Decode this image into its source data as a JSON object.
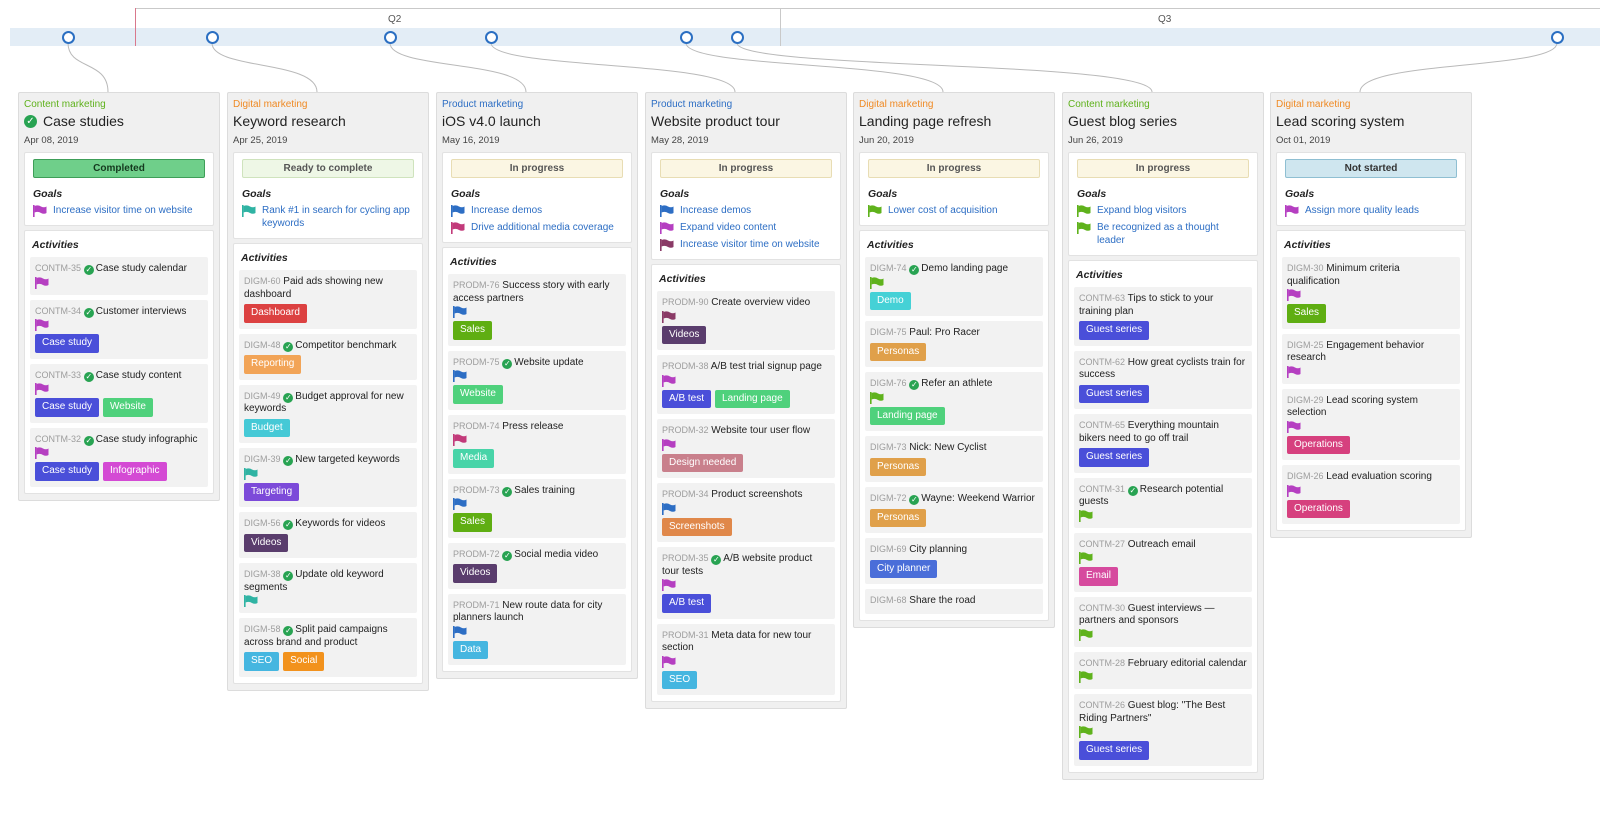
{
  "timeline": {
    "quarters": [
      "Q2",
      "Q3"
    ]
  },
  "categories": {
    "content": {
      "label": "Content marketing",
      "color": "#5fb21c"
    },
    "digital": {
      "label": "Digital marketing",
      "color": "#ef8a24"
    },
    "product": {
      "label": "Product marketing",
      "color": "#2d6ec4"
    }
  },
  "columns": [
    {
      "category": "Content marketing",
      "category_color": "#5fb21c",
      "title": "Case studies",
      "done": true,
      "date": "Apr 08, 2019",
      "status": "Completed",
      "status_style": "completed",
      "goals_label": "Goals",
      "goals": [
        {
          "text": "Increase visitor time on website",
          "flag": "#b53fc1"
        }
      ],
      "activities_label": "Activities",
      "activities": [
        {
          "key": "CONTM-35",
          "done": true,
          "title": "Case study calendar",
          "flag": "#b53fc1",
          "tags": []
        },
        {
          "key": "CONTM-34",
          "done": true,
          "title": "Customer interviews",
          "flag": "#b53fc1",
          "tags": [
            {
              "label": "Case study",
              "color": "#4a4fd9"
            }
          ]
        },
        {
          "key": "CONTM-33",
          "done": true,
          "title": "Case study content",
          "flag": "#b53fc1",
          "tags": [
            {
              "label": "Case study",
              "color": "#4a4fd9"
            },
            {
              "label": "Website",
              "color": "#4fd17c"
            }
          ]
        },
        {
          "key": "CONTM-32",
          "done": true,
          "title": "Case study infographic",
          "flag": "#b53fc1",
          "tags": [
            {
              "label": "Case study",
              "color": "#4a4fd9"
            },
            {
              "label": "Infographic",
              "color": "#d44ad4"
            }
          ]
        }
      ]
    },
    {
      "category": "Digital marketing",
      "category_color": "#ef8a24",
      "title": "Keyword research",
      "done": false,
      "date": "Apr 25, 2019",
      "status": "Ready to complete",
      "status_style": "ready",
      "goals_label": "Goals",
      "goals": [
        {
          "text": "Rank #1 in search for cycling app keywords",
          "flag": "#2fb3a3"
        }
      ],
      "activities_label": "Activities",
      "activities": [
        {
          "key": "DIGM-60",
          "done": false,
          "title": "Paid ads showing new dashboard",
          "flag": "",
          "tags": [
            {
              "label": "Dashboard",
              "color": "#dc4141"
            }
          ]
        },
        {
          "key": "DIGM-48",
          "done": true,
          "title": "Competitor benchmark",
          "flag": "",
          "tags": [
            {
              "label": "Reporting",
              "color": "#f2a457"
            }
          ]
        },
        {
          "key": "DIGM-49",
          "done": true,
          "title": "Budget approval for new keywords",
          "flag": "",
          "tags": [
            {
              "label": "Budget",
              "color": "#45c9d6"
            }
          ]
        },
        {
          "key": "DIGM-39",
          "done": true,
          "title": "New targeted keywords",
          "flag": "#2fb3a3",
          "tags": [
            {
              "label": "Targeting",
              "color": "#7c4ad9"
            }
          ]
        },
        {
          "key": "DIGM-56",
          "done": true,
          "title": "Keywords for videos",
          "flag": "",
          "tags": [
            {
              "label": "Videos",
              "color": "#5a3d6d"
            }
          ]
        },
        {
          "key": "DIGM-38",
          "done": true,
          "title": "Update old keyword segments",
          "flag": "#2fb3a3",
          "tags": []
        },
        {
          "key": "DIGM-58",
          "done": true,
          "title": "Split paid campaigns across brand and product",
          "flag": "",
          "tags": [
            {
              "label": "SEO",
              "color": "#45b6e0"
            },
            {
              "label": "Social",
              "color": "#f2921d"
            }
          ]
        }
      ]
    },
    {
      "category": "Product marketing",
      "category_color": "#2d6ec4",
      "title": "iOS v4.0 launch",
      "done": false,
      "date": "May 16, 2019",
      "status": "In progress",
      "status_style": "progress",
      "goals_label": "Goals",
      "goals": [
        {
          "text": "Increase demos",
          "flag": "#2d6ec4"
        },
        {
          "text": "Drive additional media coverage",
          "flag": "#c23a7a"
        }
      ],
      "activities_label": "Activities",
      "activities": [
        {
          "key": "PRODM-76",
          "done": false,
          "title": "Success story with early access partners",
          "flag": "#2d6ec4",
          "tags": [
            {
              "label": "Sales",
              "color": "#5fae12"
            }
          ]
        },
        {
          "key": "PRODM-75",
          "done": true,
          "title": "Website update",
          "flag": "#2d6ec4",
          "tags": [
            {
              "label": "Website",
              "color": "#4fd17c"
            }
          ]
        },
        {
          "key": "PRODM-74",
          "done": false,
          "title": "Press release",
          "flag": "#c23a7a",
          "tags": [
            {
              "label": "Media",
              "color": "#48d4a8"
            }
          ]
        },
        {
          "key": "PRODM-73",
          "done": true,
          "title": "Sales training",
          "flag": "#2d6ec4",
          "tags": [
            {
              "label": "Sales",
              "color": "#5fae12"
            }
          ]
        },
        {
          "key": "PRODM-72",
          "done": true,
          "title": "Social media video",
          "flag": "",
          "tags": [
            {
              "label": "Videos",
              "color": "#5a3d6d"
            }
          ]
        },
        {
          "key": "PRODM-71",
          "done": false,
          "title": "New route data for city planners launch",
          "flag": "#2d6ec4",
          "tags": [
            {
              "label": "Data",
              "color": "#45b6e0"
            }
          ]
        }
      ]
    },
    {
      "category": "Product marketing",
      "category_color": "#2d6ec4",
      "title": "Website product tour",
      "done": false,
      "date": "May 28, 2019",
      "status": "In progress",
      "status_style": "progress",
      "goals_label": "Goals",
      "goals": [
        {
          "text": "Increase demos",
          "flag": "#2d6ec4"
        },
        {
          "text": "Expand video content",
          "flag": "#b53fc1"
        },
        {
          "text": "Increase visitor time on website",
          "flag": "#8a3a66"
        }
      ],
      "activities_label": "Activities",
      "activities": [
        {
          "key": "PRODM-90",
          "done": false,
          "title": "Create overview video",
          "flag": "#8a3a66",
          "tags": [
            {
              "label": "Videos",
              "color": "#5a3d6d"
            }
          ]
        },
        {
          "key": "PRODM-38",
          "done": false,
          "title": "A/B test trial signup page",
          "flag": "#b53fc1",
          "tags": [
            {
              "label": "A/B test",
              "color": "#4a4fd9"
            },
            {
              "label": "Landing page",
              "color": "#4fd17c"
            }
          ]
        },
        {
          "key": "PRODM-32",
          "done": false,
          "title": "Website tour user flow",
          "flag": "#b53fc1",
          "tags": [
            {
              "label": "Design needed",
              "color": "#c9808c"
            }
          ]
        },
        {
          "key": "PRODM-34",
          "done": false,
          "title": "Product screenshots",
          "flag": "#2d6ec4",
          "tags": [
            {
              "label": "Screenshots",
              "color": "#e0884a"
            }
          ]
        },
        {
          "key": "PRODM-35",
          "done": true,
          "title": "A/B website product tour tests",
          "flag": "#b53fc1",
          "tags": [
            {
              "label": "A/B test",
              "color": "#4a4fd9"
            }
          ]
        },
        {
          "key": "PRODM-31",
          "done": false,
          "title": "Meta data for new tour section",
          "flag": "#b53fc1",
          "tags": [
            {
              "label": "SEO",
              "color": "#45b6e0"
            }
          ]
        }
      ]
    },
    {
      "category": "Digital marketing",
      "category_color": "#ef8a24",
      "title": "Landing page refresh",
      "done": false,
      "date": "Jun 20, 2019",
      "status": "In progress",
      "status_style": "progress",
      "goals_label": "Goals",
      "goals": [
        {
          "text": "Lower cost of acquisition",
          "flag": "#5fb21c"
        }
      ],
      "activities_label": "Activities",
      "activities": [
        {
          "key": "DIGM-74",
          "done": true,
          "title": "Demo landing page",
          "flag": "#5fb21c",
          "tags": [
            {
              "label": "Demo",
              "color": "#45d1d6"
            }
          ]
        },
        {
          "key": "DIGM-75",
          "done": false,
          "title": "Paul: Pro Racer",
          "flag": "",
          "tags": [
            {
              "label": "Personas",
              "color": "#e0a04a"
            }
          ]
        },
        {
          "key": "DIGM-76",
          "done": true,
          "title": "Refer an athlete",
          "flag": "#5fb21c",
          "tags": [
            {
              "label": "Landing page",
              "color": "#4fd17c"
            }
          ]
        },
        {
          "key": "DIGM-73",
          "done": false,
          "title": "Nick: New Cyclist",
          "flag": "",
          "tags": [
            {
              "label": "Personas",
              "color": "#e0a04a"
            }
          ]
        },
        {
          "key": "DIGM-72",
          "done": true,
          "title": "Wayne: Weekend Warrior",
          "flag": "",
          "tags": [
            {
              "label": "Personas",
              "color": "#e0a04a"
            }
          ]
        },
        {
          "key": "DIGM-69",
          "done": false,
          "title": "City planning",
          "flag": "",
          "tags": [
            {
              "label": "City planner",
              "color": "#4a6ed9"
            }
          ]
        },
        {
          "key": "DIGM-68",
          "done": false,
          "title": "Share the road",
          "flag": "",
          "tags": []
        }
      ]
    },
    {
      "category": "Content marketing",
      "category_color": "#5fb21c",
      "title": "Guest blog series",
      "done": false,
      "date": "Jun 26, 2019",
      "status": "In progress",
      "status_style": "progress",
      "goals_label": "Goals",
      "goals": [
        {
          "text": "Expand blog visitors",
          "flag": "#5fb21c"
        },
        {
          "text": "Be recognized as a thought leader",
          "flag": "#5fb21c"
        }
      ],
      "activities_label": "Activities",
      "activities": [
        {
          "key": "CONTM-63",
          "done": false,
          "title": "Tips to stick to your training plan",
          "flag": "",
          "tags": [
            {
              "label": "Guest series",
              "color": "#4a4fd9"
            }
          ]
        },
        {
          "key": "CONTM-62",
          "done": false,
          "title": "How great cyclists train for success",
          "flag": "",
          "tags": [
            {
              "label": "Guest series",
              "color": "#4a4fd9"
            }
          ]
        },
        {
          "key": "CONTM-65",
          "done": false,
          "title": "Everything mountain bikers need to go off trail",
          "flag": "",
          "tags": [
            {
              "label": "Guest series",
              "color": "#4a4fd9"
            }
          ]
        },
        {
          "key": "CONTM-31",
          "done": true,
          "title": "Research potential guests",
          "flag": "#5fb21c",
          "tags": []
        },
        {
          "key": "CONTM-27",
          "done": false,
          "title": "Outreach email",
          "flag": "#5fb21c",
          "tags": [
            {
              "label": "Email",
              "color": "#d64a9e"
            }
          ]
        },
        {
          "key": "CONTM-30",
          "done": false,
          "title": "Guest interviews — partners and sponsors",
          "flag": "#5fb21c",
          "tags": []
        },
        {
          "key": "CONTM-28",
          "done": false,
          "title": "February editorial calendar",
          "flag": "#5fb21c",
          "tags": []
        },
        {
          "key": "CONTM-26",
          "done": false,
          "title": "Guest blog: \"The Best Riding Partners\"",
          "flag": "#5fb21c",
          "tags": [
            {
              "label": "Guest series",
              "color": "#4a4fd9"
            }
          ]
        }
      ]
    },
    {
      "category": "Digital marketing",
      "category_color": "#ef8a24",
      "title": "Lead scoring system",
      "done": false,
      "date": "Oct 01, 2019",
      "status": "Not started",
      "status_style": "notstarted",
      "goals_label": "Goals",
      "goals": [
        {
          "text": "Assign more quality leads",
          "flag": "#b53fc1"
        }
      ],
      "activities_label": "Activities",
      "activities": [
        {
          "key": "DIGM-30",
          "done": false,
          "title": "Minimum criteria qualification",
          "flag": "#b53fc1",
          "tags": [
            {
              "label": "Sales",
              "color": "#5fae12"
            }
          ]
        },
        {
          "key": "DIGM-25",
          "done": false,
          "title": "Engagement behavior research",
          "flag": "#b53fc1",
          "tags": []
        },
        {
          "key": "DIGM-29",
          "done": false,
          "title": "Lead scoring system selection",
          "flag": "#b53fc1",
          "tags": [
            {
              "label": "Operations",
              "color": "#d6407e"
            }
          ]
        },
        {
          "key": "DIGM-26",
          "done": false,
          "title": "Lead evaluation scoring",
          "flag": "#b53fc1",
          "tags": [
            {
              "label": "Operations",
              "color": "#d6407e"
            }
          ]
        }
      ]
    }
  ]
}
